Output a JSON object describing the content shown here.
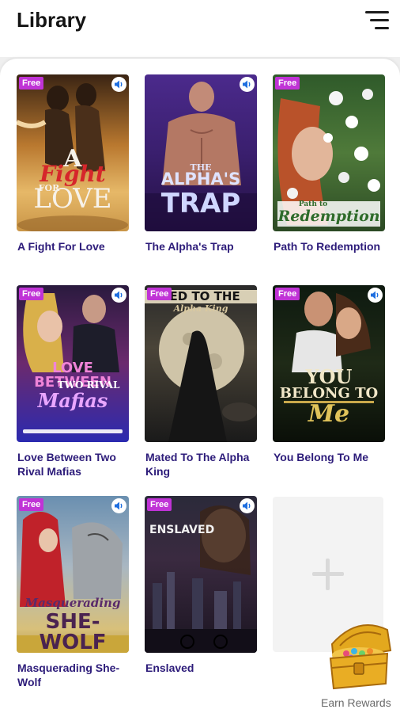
{
  "header": {
    "title": "Library",
    "menu_icon": "hamburger-menu-icon"
  },
  "badges": {
    "free": "Free",
    "audio_icon": "speaker-icon"
  },
  "books": [
    {
      "title": "A Fight For Love",
      "free": true,
      "audio": true,
      "cover_lines": [
        "A",
        "Fight",
        "FOR",
        "LOVE"
      ]
    },
    {
      "title": "The Alpha's Trap",
      "free": false,
      "audio": true,
      "cover_lines": [
        "THE",
        "ALPHA'S",
        "TRAP"
      ]
    },
    {
      "title": "Path To Redemption",
      "free": true,
      "audio": false,
      "cover_lines": [
        "Path to",
        "Redemption"
      ]
    },
    {
      "title": "Love Between Two Rival Mafias",
      "free": true,
      "audio": true,
      "cover_lines": [
        "LOVE BETWEEN",
        "TWO RIVAL",
        "Mafias"
      ]
    },
    {
      "title": "Mated To The Alpha King",
      "free": true,
      "audio": false,
      "cover_lines": [
        "TED TO THE",
        "Alpha King"
      ]
    },
    {
      "title": "You Belong To Me",
      "free": true,
      "audio": true,
      "cover_lines": [
        "YOU",
        "BELONG TO",
        "Me"
      ]
    },
    {
      "title": "Masquerading She-Wolf",
      "free": true,
      "audio": true,
      "cover_lines": [
        "Masquerading",
        "SHE-WOLF"
      ]
    },
    {
      "title": "Enslaved",
      "free": true,
      "audio": true,
      "cover_lines": [
        "ENSLAVED"
      ]
    }
  ],
  "add_card": {
    "icon": "plus-icon"
  },
  "rewards": {
    "label": "Earn Rewards",
    "icon": "treasure-chest-icon"
  },
  "colors": {
    "accent": "#c033d6",
    "book_title": "#2d1c7a",
    "audio": "#1f6fe0"
  }
}
